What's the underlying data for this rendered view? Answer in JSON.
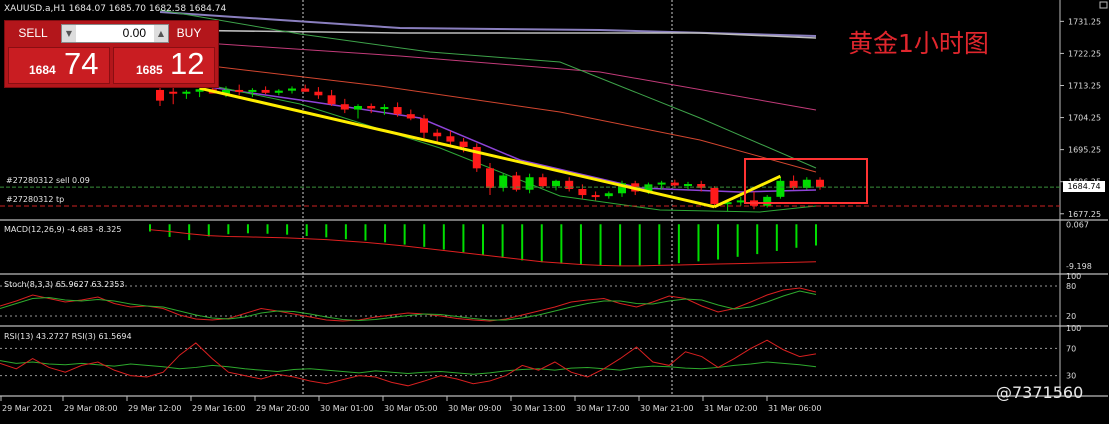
{
  "symbol_title": "XAUUSD.a,H1  1684.07 1685.70 1682.58 1684.74",
  "annotation_cn": "黄金1小时图",
  "watermark": "@7371560",
  "trade_panel": {
    "sell_label": "SELL",
    "buy_label": "BUY",
    "lot_value": "0.00",
    "sell_price_small": "1684",
    "sell_price_big": "74",
    "buy_price_small": "1685",
    "buy_price_big": "12"
  },
  "orders": {
    "sell_label": "#27280312 sell 0.09",
    "tp_label": "#27280312 tp"
  },
  "current_price_tag": "1684.74",
  "indicators": {
    "macd_label": "MACD(12,26,9) -4.683 -8.325",
    "stoch_label": "Stoch(8,3,3) 65.9627 63.2353",
    "rsi_label": "RSI(13) 43.2727  RSI(3) 61.5694"
  },
  "colors": {
    "bull": "#00dd00",
    "bear": "#ff1a1a",
    "trendline": "#ffee00",
    "highlight_box": "#ff3333"
  },
  "chart_data": [
    {
      "type": "candlestick",
      "title": "XAUUSD.a,H1",
      "x_ticks": [
        "29 Mar 2021",
        "29 Mar 08:00",
        "29 Mar 12:00",
        "29 Mar 16:00",
        "29 Mar 20:00",
        "30 Mar 01:00",
        "30 Mar 05:00",
        "30 Mar 09:00",
        "30 Mar 13:00",
        "30 Mar 17:00",
        "30 Mar 21:00",
        "31 Mar 02:00",
        "31 Mar 06:00"
      ],
      "y_ticks": [
        1731.25,
        1722.25,
        1713.25,
        1704.25,
        1695.25,
        1686.25,
        1677.25
      ],
      "ylim": [
        1675.5,
        1735.0
      ],
      "candles": [
        {
          "o": 1712.0,
          "h": 1713.5,
          "l": 1707.5,
          "c": 1709.0
        },
        {
          "o": 1711.5,
          "h": 1713.0,
          "l": 1708.0,
          "c": 1711.0
        },
        {
          "o": 1711.0,
          "h": 1712.0,
          "l": 1709.5,
          "c": 1711.5
        },
        {
          "o": 1711.5,
          "h": 1713.0,
          "l": 1710.0,
          "c": 1712.2
        },
        {
          "o": 1712.2,
          "h": 1713.6,
          "l": 1711.0,
          "c": 1711.0
        },
        {
          "o": 1711.0,
          "h": 1713.0,
          "l": 1710.0,
          "c": 1712.0
        },
        {
          "o": 1712.0,
          "h": 1713.5,
          "l": 1710.5,
          "c": 1711.5
        },
        {
          "o": 1711.5,
          "h": 1712.5,
          "l": 1710.0,
          "c": 1712.0
        },
        {
          "o": 1712.0,
          "h": 1713.0,
          "l": 1710.8,
          "c": 1711.2
        },
        {
          "o": 1711.2,
          "h": 1712.2,
          "l": 1710.5,
          "c": 1711.8
        },
        {
          "o": 1711.8,
          "h": 1713.0,
          "l": 1711.0,
          "c": 1712.4
        },
        {
          "o": 1712.4,
          "h": 1713.5,
          "l": 1711.5,
          "c": 1711.5
        },
        {
          "o": 1711.5,
          "h": 1712.8,
          "l": 1709.5,
          "c": 1710.5
        },
        {
          "o": 1710.5,
          "h": 1712.0,
          "l": 1707.5,
          "c": 1708.0
        },
        {
          "o": 1708.0,
          "h": 1709.5,
          "l": 1705.5,
          "c": 1706.5
        },
        {
          "o": 1706.5,
          "h": 1708.0,
          "l": 1704.0,
          "c": 1707.5
        },
        {
          "o": 1707.5,
          "h": 1708.2,
          "l": 1705.5,
          "c": 1706.8
        },
        {
          "o": 1706.8,
          "h": 1708.0,
          "l": 1705.0,
          "c": 1707.2
        },
        {
          "o": 1707.2,
          "h": 1708.5,
          "l": 1704.5,
          "c": 1705.2
        },
        {
          "o": 1705.2,
          "h": 1706.5,
          "l": 1703.5,
          "c": 1704.0
        },
        {
          "o": 1704.0,
          "h": 1705.0,
          "l": 1698.5,
          "c": 1700.0
        },
        {
          "o": 1700.0,
          "h": 1701.0,
          "l": 1697.0,
          "c": 1699.0
        },
        {
          "o": 1699.0,
          "h": 1700.5,
          "l": 1696.5,
          "c": 1697.5
        },
        {
          "o": 1697.5,
          "h": 1698.5,
          "l": 1694.5,
          "c": 1696.0
        },
        {
          "o": 1696.0,
          "h": 1697.0,
          "l": 1689.0,
          "c": 1690.0
        },
        {
          "o": 1690.0,
          "h": 1691.5,
          "l": 1682.5,
          "c": 1684.5
        },
        {
          "o": 1684.5,
          "h": 1688.5,
          "l": 1683.5,
          "c": 1688.0
        },
        {
          "o": 1688.0,
          "h": 1689.0,
          "l": 1683.5,
          "c": 1684.0
        },
        {
          "o": 1684.0,
          "h": 1688.5,
          "l": 1683.0,
          "c": 1687.5
        },
        {
          "o": 1687.5,
          "h": 1688.5,
          "l": 1684.5,
          "c": 1685.0
        },
        {
          "o": 1685.0,
          "h": 1686.8,
          "l": 1683.8,
          "c": 1686.5
        },
        {
          "o": 1686.5,
          "h": 1687.5,
          "l": 1683.5,
          "c": 1684.2
        },
        {
          "o": 1684.2,
          "h": 1685.5,
          "l": 1681.5,
          "c": 1682.5
        },
        {
          "o": 1682.5,
          "h": 1683.5,
          "l": 1681.0,
          "c": 1682.2
        },
        {
          "o": 1682.2,
          "h": 1683.5,
          "l": 1681.5,
          "c": 1683.0
        },
        {
          "o": 1683.0,
          "h": 1686.5,
          "l": 1682.0,
          "c": 1685.8
        },
        {
          "o": 1685.8,
          "h": 1686.5,
          "l": 1682.5,
          "c": 1683.5
        },
        {
          "o": 1683.5,
          "h": 1686.0,
          "l": 1682.8,
          "c": 1685.5
        },
        {
          "o": 1685.5,
          "h": 1686.5,
          "l": 1684.0,
          "c": 1686.0
        },
        {
          "o": 1686.0,
          "h": 1686.8,
          "l": 1684.5,
          "c": 1685.2
        },
        {
          "o": 1685.2,
          "h": 1686.2,
          "l": 1684.0,
          "c": 1685.6
        },
        {
          "o": 1685.6,
          "h": 1686.5,
          "l": 1683.5,
          "c": 1684.5
        },
        {
          "o": 1684.5,
          "h": 1685.0,
          "l": 1679.0,
          "c": 1680.0
        },
        {
          "o": 1680.0,
          "h": 1681.0,
          "l": 1678.0,
          "c": 1680.5
        },
        {
          "o": 1680.5,
          "h": 1682.0,
          "l": 1679.5,
          "c": 1681.0
        },
        {
          "o": 1681.0,
          "h": 1683.5,
          "l": 1678.5,
          "c": 1679.5
        },
        {
          "o": 1679.5,
          "h": 1682.5,
          "l": 1679.0,
          "c": 1682.0
        },
        {
          "o": 1682.0,
          "h": 1687.5,
          "l": 1681.5,
          "c": 1686.5
        },
        {
          "o": 1686.5,
          "h": 1688.0,
          "l": 1684.0,
          "c": 1684.5
        },
        {
          "o": 1684.5,
          "h": 1687.5,
          "l": 1684.0,
          "c": 1686.8
        },
        {
          "o": 1686.8,
          "h": 1687.5,
          "l": 1684.0,
          "c": 1684.7
        }
      ]
    },
    {
      "type": "histogram",
      "title": "MACD(12,26,9) -4.683 -8.325",
      "y_ticks": [
        "0.067",
        "-9.198"
      ],
      "ylim": [
        -11.0,
        0.5
      ],
      "histogram": [
        -1.6,
        -2.8,
        -3.5,
        -2.7,
        -2.2,
        -2.0,
        -2.1,
        -2.3,
        -2.6,
        -2.9,
        -3.3,
        -3.6,
        -4.0,
        -4.5,
        -5.0,
        -5.6,
        -6.2,
        -6.8,
        -7.4,
        -8.0,
        -8.4,
        -8.7,
        -8.9,
        -9.1,
        -9.2,
        -9.1,
        -8.9,
        -8.6,
        -8.2,
        -7.8,
        -7.2,
        -6.6,
        -5.9,
        -5.2,
        -4.7
      ],
      "signal": [
        -1.2,
        -1.6,
        -2.1,
        -2.5,
        -2.7,
        -2.8,
        -2.9,
        -3.0,
        -3.2,
        -3.4,
        -3.7,
        -4.0,
        -4.4,
        -4.8,
        -5.3,
        -5.8,
        -6.3,
        -6.8,
        -7.3,
        -7.8,
        -8.3,
        -8.6,
        -8.9,
        -9.1,
        -9.2,
        -9.2,
        -9.1,
        -9.0,
        -8.9,
        -8.8,
        -8.7,
        -8.6,
        -8.5,
        -8.4,
        -8.3
      ]
    },
    {
      "type": "line",
      "title": "Stoch(8,3,3) 65.9627 63.2353",
      "y_ticks": [
        "100",
        "80",
        "20"
      ],
      "ylim": [
        0,
        100
      ],
      "series": [
        {
          "values": [
            40,
            50,
            62,
            55,
            48,
            52,
            58,
            45,
            38,
            40,
            35,
            22,
            14,
            12,
            15,
            25,
            35,
            30,
            24,
            18,
            12,
            10,
            12,
            18,
            22,
            26,
            24,
            20,
            15,
            12,
            10,
            14,
            22,
            30,
            38,
            48,
            52,
            55,
            45,
            38,
            48,
            60,
            55,
            40,
            28,
            35,
            48,
            62,
            72,
            76,
            68
          ]
        },
        {
          "values": [
            35,
            45,
            55,
            57,
            52,
            50,
            53,
            50,
            44,
            40,
            38,
            30,
            22,
            16,
            14,
            18,
            26,
            30,
            29,
            24,
            18,
            13,
            11,
            13,
            17,
            21,
            24,
            23,
            19,
            15,
            12,
            12,
            16,
            22,
            30,
            38,
            45,
            50,
            50,
            45,
            44,
            50,
            54,
            52,
            42,
            34,
            38,
            48,
            60,
            70,
            63
          ]
        }
      ]
    },
    {
      "type": "line",
      "title": "RSI(13) 43.2727  RSI(3) 61.5694",
      "y_ticks": [
        "100",
        "70",
        "30"
      ],
      "ylim": [
        0,
        100
      ],
      "series": [
        {
          "values": [
            52,
            48,
            50,
            47,
            46,
            48,
            46,
            44,
            47,
            45,
            43,
            40,
            42,
            45,
            43,
            40,
            38,
            36,
            39,
            40,
            38,
            36,
            34,
            37,
            35,
            33,
            35,
            36,
            34,
            32,
            34,
            37,
            39,
            40,
            38,
            41,
            42,
            40,
            38,
            42,
            44,
            43,
            41,
            40,
            42,
            45,
            47,
            50,
            48,
            46,
            43
          ]
        },
        {
          "values": [
            48,
            40,
            55,
            42,
            35,
            45,
            50,
            38,
            30,
            28,
            35,
            60,
            78,
            55,
            35,
            30,
            25,
            32,
            28,
            22,
            18,
            24,
            30,
            28,
            20,
            15,
            22,
            30,
            25,
            18,
            22,
            30,
            45,
            38,
            50,
            35,
            28,
            40,
            55,
            72,
            50,
            45,
            65,
            58,
            42,
            55,
            70,
            82,
            68,
            58,
            62
          ]
        }
      ]
    }
  ]
}
